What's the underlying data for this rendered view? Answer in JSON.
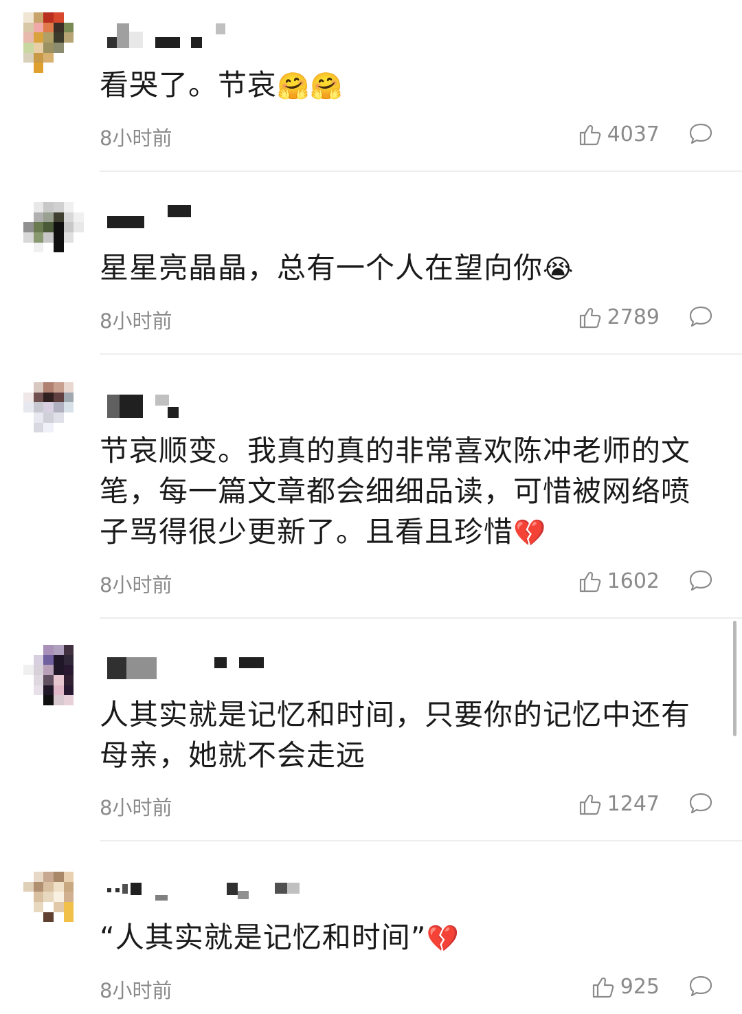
{
  "comments": [
    {
      "text": "看哭了。节哀",
      "emoji": "🤗🤗",
      "time": "8小时前",
      "likes": "4037",
      "avatar_colors": [
        "#f1e5d3",
        "#c9a46a",
        "#b92e1f",
        "#d8482d",
        "#ffffff",
        "#ffffff",
        "#d8c8a8",
        "#f0a8a8",
        "#e07a4a",
        "#3a2e26",
        "#7a8a55",
        "#ffffff",
        "#e8b9ad",
        "#d9a23c",
        "#b0a068",
        "#3b3b2b",
        "#b7a575",
        "#ffffff",
        "#c8d8a0",
        "#e8cfa8",
        "#9a9060",
        "#8c8c70",
        "#ffffff",
        "#ffffff",
        "#d8d0b8",
        "#c89a48",
        "#d8b070",
        "#ffffff",
        "#ffffff",
        "#ffffff",
        "#ffffff",
        "#e0a030",
        "#ffffff",
        "#ffffff",
        "#ffffff",
        "#ffffff"
      ]
    },
    {
      "text": "星星亮晶晶，总有一个人在望向你",
      "emoji": "😭",
      "time": "8小时前",
      "likes": "2789",
      "avatar_colors": [
        "#ffffff",
        "#e8e8e8",
        "#c8c8c8",
        "#d0d0d0",
        "#f0f0f0",
        "#ffffff",
        "#ffffff",
        "#b0b0b0",
        "#9aa090",
        "#404030",
        "#d8d8d8",
        "#f0f0f0",
        "#909090",
        "#6a7a50",
        "#4a5a38",
        "#101010",
        "#c8c8c8",
        "#e8e8e8",
        "#d8d8d8",
        "#8a9a70",
        "#c8c8c8",
        "#101010",
        "#e0e0e0",
        "#ffffff",
        "#ffffff",
        "#f0f0f0",
        "#ffffff",
        "#101010",
        "#ffffff",
        "#ffffff",
        "#ffffff",
        "#ffffff",
        "#ffffff",
        "#ffffff",
        "#ffffff",
        "#ffffff"
      ]
    },
    {
      "text": "节哀顺变。我真的真的非常喜欢陈冲老师的文笔，每一篇文章都会细细品读，可惜被网络喷子骂得很少更新了。且看且珍惜",
      "emoji": "💔",
      "time": "8小时前",
      "likes": "1602",
      "avatar_colors": [
        "#ffffff",
        "#d8c8c0",
        "#b08070",
        "#c8a090",
        "#e8d8d0",
        "#ffffff",
        "#f0e8e8",
        "#705050",
        "#302020",
        "#604040",
        "#a0a8b0",
        "#ffffff",
        "#e8e8f0",
        "#c8c8d0",
        "#d8d0e0",
        "#b0b0c0",
        "#d8e0e8",
        "#ffffff",
        "#ffffff",
        "#e8e8f0",
        "#d0d0d8",
        "#e0e0e8",
        "#ffffff",
        "#ffffff",
        "#ffffff",
        "#d8d8e0",
        "#f0f0f8",
        "#ffffff",
        "#ffffff",
        "#ffffff",
        "#ffffff",
        "#ffffff",
        "#ffffff",
        "#ffffff",
        "#ffffff",
        "#ffffff"
      ]
    },
    {
      "text": "人其实就是记忆和时间，只要你的记忆中还有母亲，她就不会走远",
      "emoji": "",
      "time": "8小时前",
      "likes": "1247",
      "avatar_colors": [
        "#ffffff",
        "#ffffff",
        "#a890b8",
        "#b0a0c0",
        "#403040",
        "#ffffff",
        "#ffffff",
        "#d8d0e0",
        "#7060a0",
        "#201828",
        "#302838",
        "#ffffff",
        "#f0f0f0",
        "#d8d0d8",
        "#b8a0b8",
        "#201828",
        "#281830",
        "#ffffff",
        "#ffffff",
        "#e0d8e0",
        "#605060",
        "#e8c8d0",
        "#302030",
        "#ffffff",
        "#ffffff",
        "#e8e0e8",
        "#201828",
        "#e0b8c8",
        "#281830",
        "#ffffff",
        "#ffffff",
        "#ffffff",
        "#101010",
        "#d8c8d0",
        "#e8d0d8",
        "#ffffff"
      ]
    },
    {
      "text": "“人其实就是记忆和时间”",
      "emoji": "💔",
      "time": "8小时前",
      "likes": "925",
      "avatar_colors": [
        "#ffffff",
        "#e8d8c8",
        "#c8a890",
        "#a88868",
        "#e8d0b0",
        "#ffffff",
        "#e0d0b8",
        "#b09070",
        "#d8c0a0",
        "#f0e0c8",
        "#c8a880",
        "#ffffff",
        "#ffffff",
        "#d8c0a0",
        "#e8d8c0",
        "#f8f0e0",
        "#d0b090",
        "#ffffff",
        "#ffffff",
        "#e8d8c0",
        "#ffffff",
        "#e0c8a8",
        "#f0c048",
        "#ffffff",
        "#ffffff",
        "#ffffff",
        "#604030",
        "#ffffff",
        "#f0c048",
        "#ffffff",
        "#ffffff",
        "#ffffff",
        "#ffffff",
        "#ffffff",
        "#ffffff",
        "#ffffff"
      ]
    }
  ]
}
